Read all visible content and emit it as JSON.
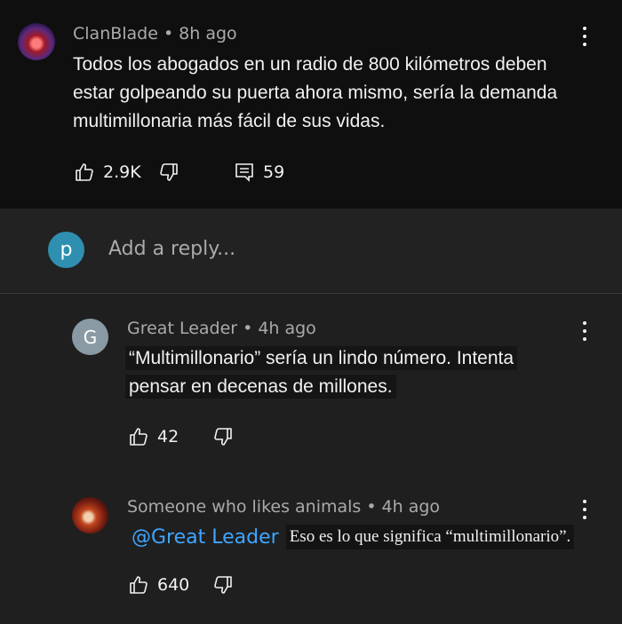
{
  "comment": {
    "author": "ClanBlade",
    "time": "8h ago",
    "text_lines": [
      "Todos los abogados en un radio de 800 kilómetros deben",
      "estar golpeando su puerta ahora mismo, sería la demanda",
      "multimillonaria más fácil de sus vidas."
    ],
    "likes": "2.9K",
    "replies": "59"
  },
  "reply_box": {
    "avatar_letter": "p",
    "placeholder": "Add a reply..."
  },
  "replies": [
    {
      "avatar_letter": "G",
      "author": "Great Leader",
      "time": "4h ago",
      "text_lines": [
        "“Multimillonario” sería un lindo número. Intenta",
        "pensar en decenas de millones."
      ],
      "likes": "42"
    },
    {
      "author": "Someone who likes animals",
      "time": "4h ago",
      "mention": "@Great Leader",
      "text": "Eso es lo que significa “multimillonario”.",
      "likes": "640"
    }
  ],
  "separator": "•"
}
